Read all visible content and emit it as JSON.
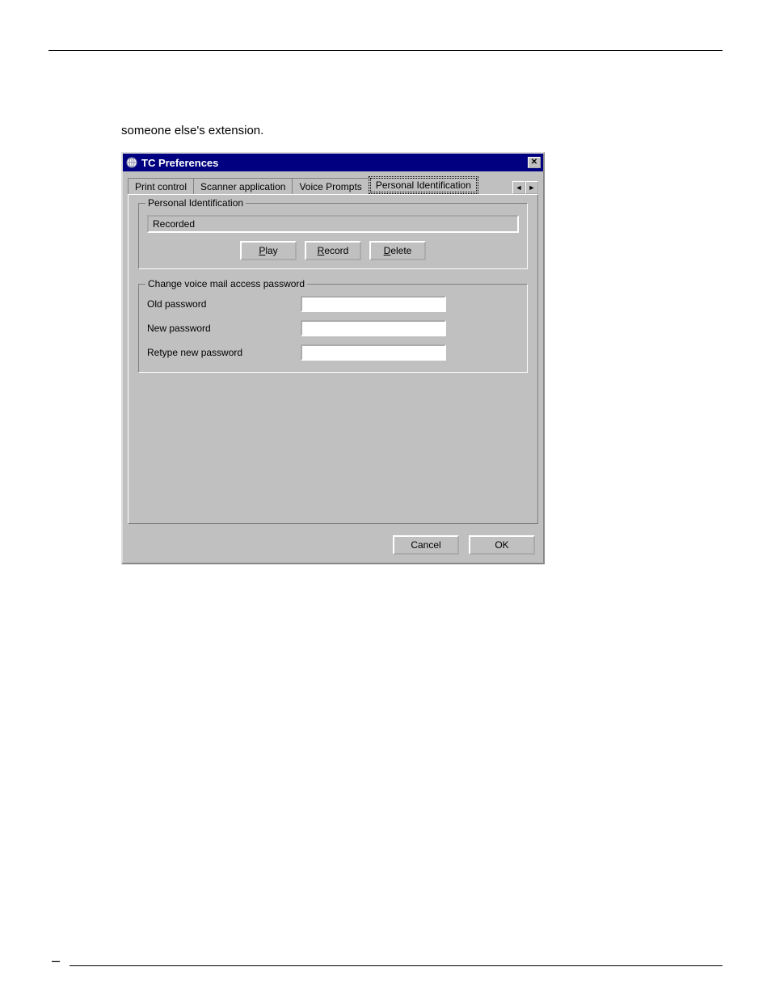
{
  "page": {
    "intro": "someone else's extension."
  },
  "dialog": {
    "title": "TC Preferences",
    "tabs": [
      "Print control",
      "Scanner application",
      "Voice Prompts",
      "Personal Identification"
    ],
    "active_tab_index": 3,
    "group1": {
      "legend": "Personal Identification",
      "status": "Recorded",
      "buttons": {
        "play": "Play",
        "record": "Record",
        "delete": "Delete"
      }
    },
    "group2": {
      "legend": "Change voice mail access password",
      "old_label": "Old password",
      "new_label": "New password",
      "retype_label": "Retype new password",
      "old_value": "",
      "new_value": "",
      "retype_value": ""
    },
    "footer": {
      "cancel": "Cancel",
      "ok": "OK"
    }
  }
}
